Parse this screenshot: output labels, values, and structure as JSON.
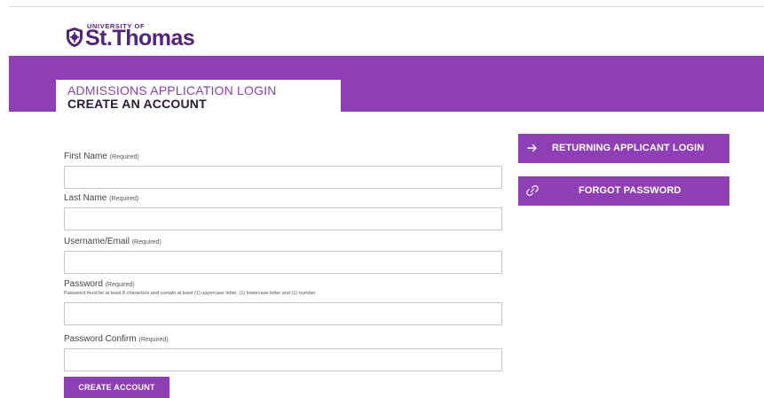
{
  "brand": {
    "small": "UNIVERSITY OF",
    "name": "St.Thomas",
    "primary_color": "#8e3fb5",
    "dark_color": "#53247c"
  },
  "header": {
    "title_line1": "ADMISSIONS APPLICATION LOGIN",
    "title_line2": "CREATE AN ACCOUNT"
  },
  "form": {
    "first_name": {
      "label": "First Name",
      "required": "(Required)",
      "value": "",
      "placeholder": ""
    },
    "last_name": {
      "label": "Last Name",
      "required": "(Required)",
      "value": "",
      "placeholder": ""
    },
    "username": {
      "label": "Username/Email",
      "required": "(Required)",
      "value": "",
      "placeholder": ""
    },
    "password": {
      "label": "Password",
      "required": "(Required)",
      "hint": "Password must be at least 8 characters and contain at least (1) uppercase letter, (1) lowercase letter and (1) number.",
      "value": "",
      "placeholder": ""
    },
    "password_confirm": {
      "label": "Password Confirm",
      "required": "(Required)",
      "value": "",
      "placeholder": ""
    },
    "submit_label": "CREATE ACCOUNT"
  },
  "side_buttons": {
    "returning": {
      "label": "RETURNING APPLICANT LOGIN",
      "icon": "arrow-right-icon"
    },
    "forgot": {
      "label": "FORGOT PASSWORD",
      "icon": "link-icon"
    }
  }
}
